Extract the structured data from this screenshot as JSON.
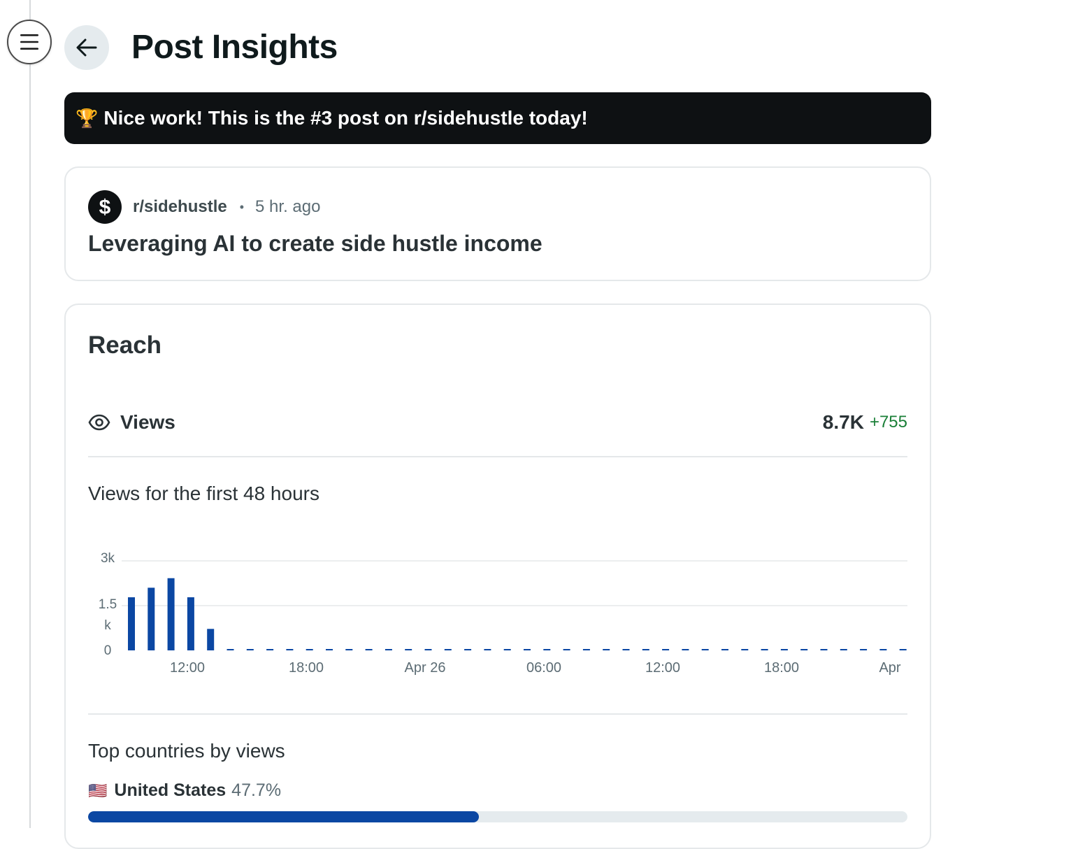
{
  "header": {
    "title": "Post Insights"
  },
  "banner": {
    "icon": "trophy-icon",
    "text": "Nice work! This is the #3 post on r/sidehustle today!"
  },
  "post": {
    "subreddit": "r/sidehustle",
    "separator": "•",
    "time": "5 hr. ago",
    "title": "Leveraging AI to create side hustle income"
  },
  "reach": {
    "title": "Reach",
    "views_label": "Views",
    "views_value": "8.7K",
    "views_delta": "+755",
    "chart_title": "Views for the first 48 hours",
    "countries_title": "Top countries by views",
    "countries": [
      {
        "flag": "🇺🇸",
        "name": "United States",
        "percent": "47.7%",
        "share": 0.477
      }
    ]
  },
  "colors": {
    "accent": "#0b47a3",
    "delta": "#1a7f37",
    "banner_bg": "#0e1113"
  },
  "chart_data": {
    "type": "bar",
    "title": "Views for the first 48 hours",
    "y_ticks": [
      "3k",
      "1.5 k",
      "0"
    ],
    "x_ticks": [
      "12:00",
      "18:00",
      "Apr 26",
      "06:00",
      "12:00",
      "18:00",
      "Apr"
    ],
    "ylim": [
      0,
      3000
    ],
    "values": [
      1780,
      2100,
      2420,
      1780,
      720,
      0,
      0,
      0,
      0,
      0,
      0,
      0,
      0,
      0,
      0,
      0,
      0,
      0,
      0,
      0,
      0,
      0,
      0,
      0,
      0,
      0,
      0,
      0,
      0,
      0,
      0,
      0,
      0,
      0,
      0,
      0,
      0,
      0,
      0,
      0,
      0
    ],
    "grid": true
  }
}
